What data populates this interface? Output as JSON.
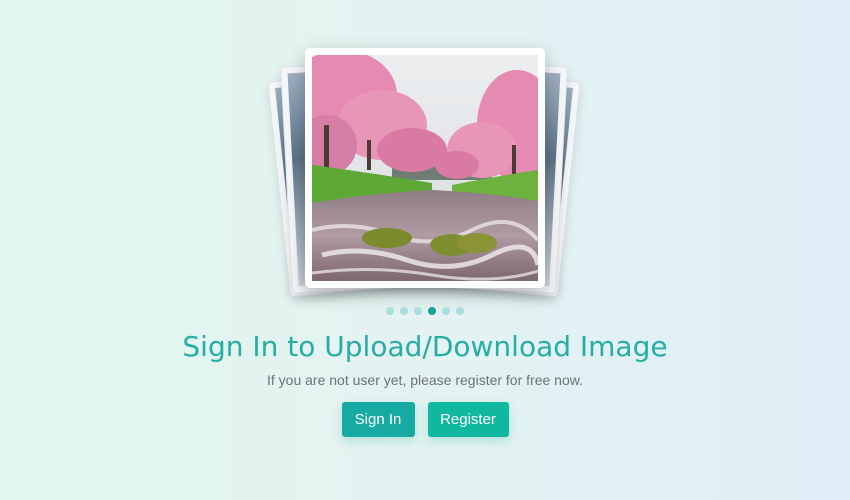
{
  "gallery": {
    "slide_count": 6,
    "active_index": 3,
    "front_image": "cherry-blossom-river-photo"
  },
  "hero": {
    "title": "Sign In to Upload/Download Image",
    "subtitle": "If you are not user yet, please register for free now."
  },
  "actions": {
    "signin_label": "Sign In",
    "register_label": "Register"
  },
  "colors": {
    "accent": "#26aea4",
    "button_signin": "#17aaa3",
    "button_register": "#11b8a0",
    "dot_inactive": "#a8dedb",
    "dot_active": "#1aa39a"
  }
}
